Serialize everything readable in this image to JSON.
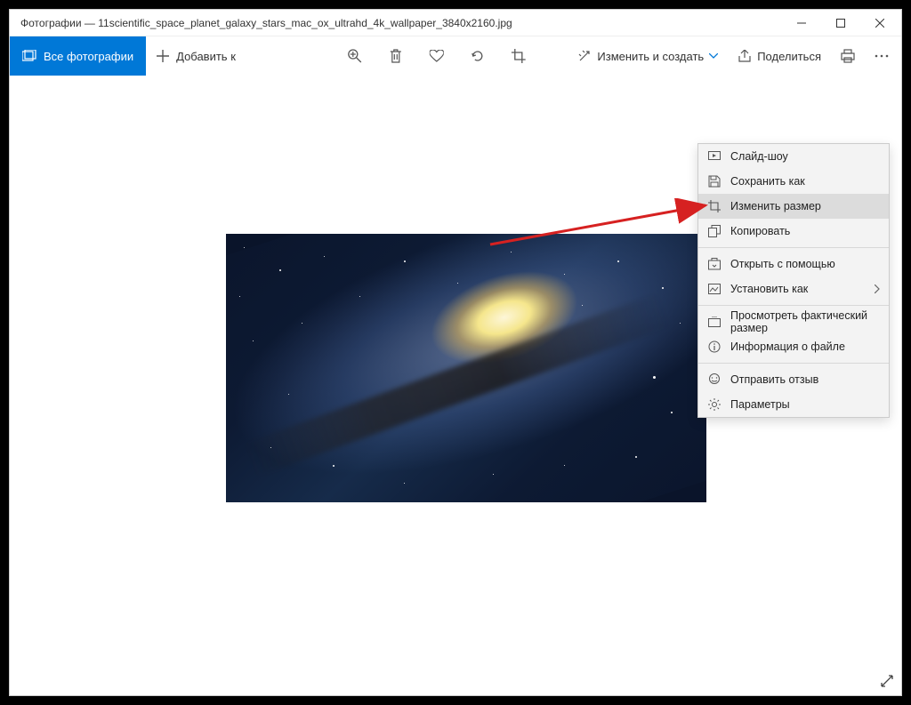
{
  "titlebar": {
    "app": "Фотографии",
    "filename": "11scientific_space_planet_galaxy_stars_mac_ox_ultrahd_4k_wallpaper_3840x2160.jpg"
  },
  "toolbar": {
    "all_photos": "Все фотографии",
    "add_to": "Добавить к",
    "edit_create": "Изменить и создать",
    "share": "Поделиться"
  },
  "menu": {
    "slideshow": "Слайд-шоу",
    "save_as": "Сохранить как",
    "resize": "Изменить размер",
    "copy": "Копировать",
    "open_with": "Открыть с помощью",
    "set_as": "Установить как",
    "actual_size": "Просмотреть фактический размер",
    "file_info": "Информация о файле",
    "send_feedback": "Отправить отзыв",
    "settings": "Параметры"
  }
}
